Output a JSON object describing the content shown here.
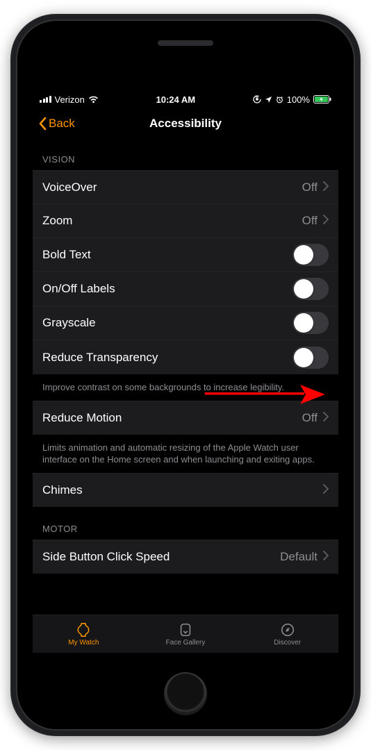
{
  "status": {
    "carrier": "Verizon",
    "time": "10:24 AM",
    "battery": "100%"
  },
  "nav": {
    "back": "Back",
    "title": "Accessibility"
  },
  "sections": {
    "vision_header": "VISION",
    "vision_footer": "Improve contrast on some backgrounds to increase legibility.",
    "motion_footer": "Limits animation and automatic resizing of the Apple Watch user interface on the Home screen and when launching and exiting apps.",
    "motor_header": "MOTOR"
  },
  "rows": {
    "voiceover": {
      "label": "VoiceOver",
      "value": "Off"
    },
    "zoom": {
      "label": "Zoom",
      "value": "Off"
    },
    "bold_text": {
      "label": "Bold Text"
    },
    "onoff": {
      "label": "On/Off Labels"
    },
    "grayscale": {
      "label": "Grayscale"
    },
    "reduce_transparency": {
      "label": "Reduce Transparency"
    },
    "reduce_motion": {
      "label": "Reduce Motion",
      "value": "Off"
    },
    "chimes": {
      "label": "Chimes"
    },
    "side_button": {
      "label": "Side Button Click Speed",
      "value": "Default"
    }
  },
  "tabs": {
    "my_watch": "My Watch",
    "face_gallery": "Face Gallery",
    "discover": "Discover"
  },
  "colors": {
    "accent": "#ff9500"
  }
}
